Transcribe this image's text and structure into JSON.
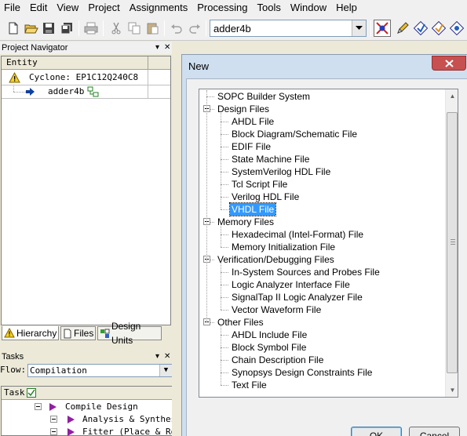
{
  "menubar": {
    "items": [
      "File",
      "Edit",
      "View",
      "Project",
      "Assignments",
      "Processing",
      "Tools",
      "Window",
      "Help"
    ]
  },
  "toolbar": {
    "entity_value": "adder4b"
  },
  "project_navigator": {
    "title": "Project Navigator",
    "column_header": "Entity",
    "device": "Cyclone: EP1C12Q240C8",
    "entity": "adder4b",
    "tabs": [
      "Hierarchy",
      "Files",
      "Design Units"
    ]
  },
  "tasks": {
    "title": "Tasks",
    "flow_label": "Flow:",
    "flow_value": "Compilation",
    "column_header": "Task",
    "rows": [
      "Compile Design",
      "Analysis & Synthesi",
      "Fitter (Place & Rou"
    ]
  },
  "dialog": {
    "title": "New",
    "ok_label": "OK",
    "cancel_label": "Cancel",
    "tree": [
      {
        "label": "SOPC Builder System",
        "level": 0,
        "expandable": false
      },
      {
        "label": "Design Files",
        "level": 0,
        "expandable": true
      },
      {
        "label": "AHDL File",
        "level": 1
      },
      {
        "label": "Block Diagram/Schematic File",
        "level": 1
      },
      {
        "label": "EDIF File",
        "level": 1
      },
      {
        "label": "State Machine File",
        "level": 1
      },
      {
        "label": "SystemVerilog HDL File",
        "level": 1
      },
      {
        "label": "Tcl Script File",
        "level": 1
      },
      {
        "label": "Verilog HDL File",
        "level": 1
      },
      {
        "label": "VHDL File",
        "level": 1,
        "selected": true
      },
      {
        "label": "Memory Files",
        "level": 0,
        "expandable": true
      },
      {
        "label": "Hexadecimal (Intel-Format) File",
        "level": 1
      },
      {
        "label": "Memory Initialization File",
        "level": 1
      },
      {
        "label": "Verification/Debugging Files",
        "level": 0,
        "expandable": true
      },
      {
        "label": "In-System Sources and Probes File",
        "level": 1
      },
      {
        "label": "Logic Analyzer Interface File",
        "level": 1
      },
      {
        "label": "SignalTap II Logic Analyzer File",
        "level": 1
      },
      {
        "label": "Vector Waveform File",
        "level": 1
      },
      {
        "label": "Other Files",
        "level": 0,
        "expandable": true
      },
      {
        "label": "AHDL Include File",
        "level": 1
      },
      {
        "label": "Block Symbol File",
        "level": 1
      },
      {
        "label": "Chain Description File",
        "level": 1
      },
      {
        "label": "Synopsys Design Constraints File",
        "level": 1
      },
      {
        "label": "Text File",
        "level": 1
      }
    ]
  },
  "colors": {
    "selection": "#3399ff",
    "close_button": "#c75050",
    "dialog_frame": "#cfdff0"
  }
}
